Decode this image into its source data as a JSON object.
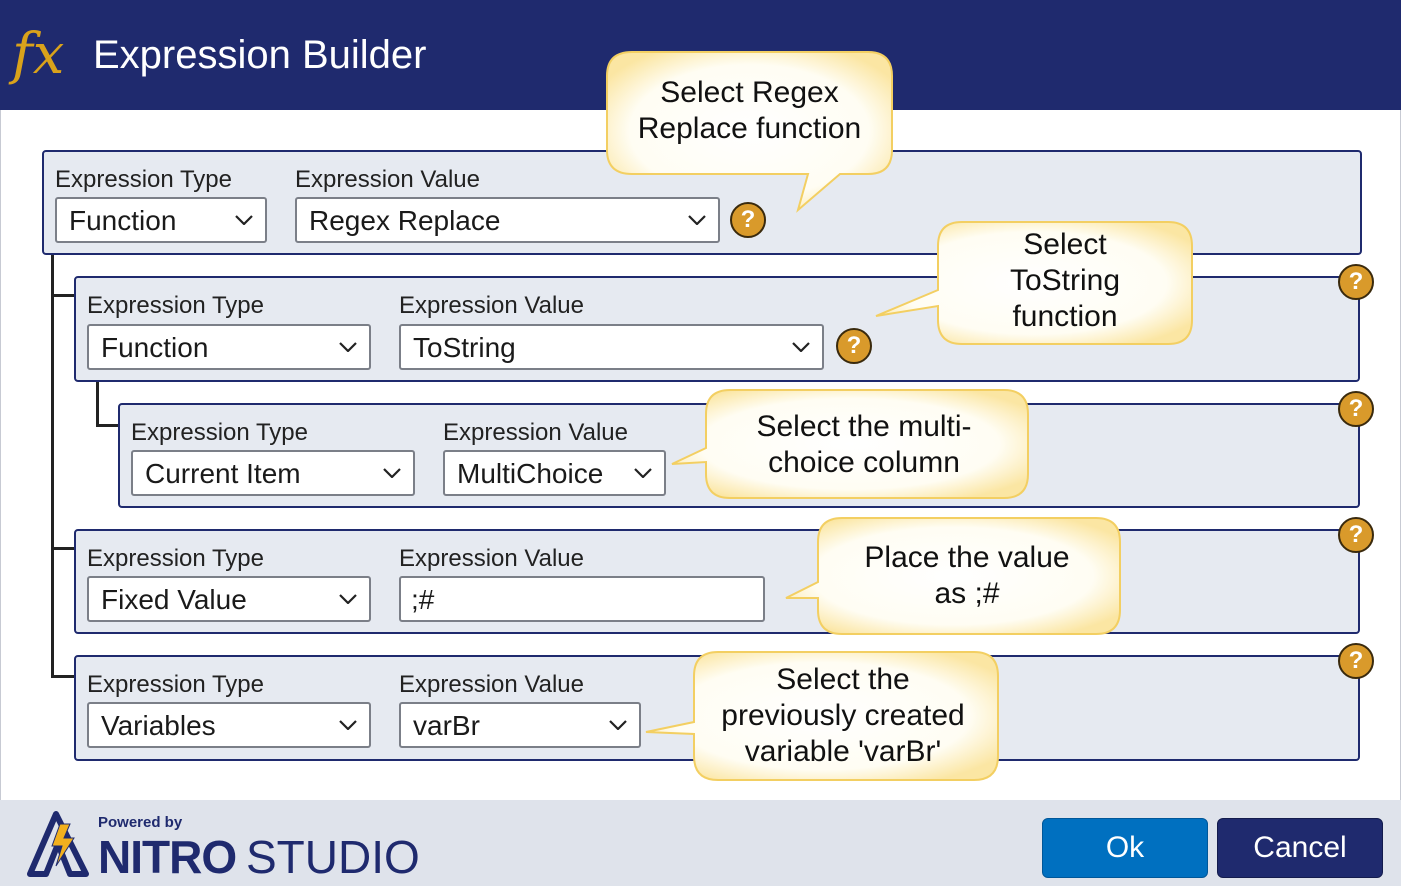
{
  "window": {
    "title": "Expression Builder",
    "icon": "fx-icon",
    "icon_text": "fx"
  },
  "labels": {
    "type": "Expression Type",
    "value": "Expression Value"
  },
  "rows": [
    {
      "type": "Function",
      "value": "Regex Replace"
    },
    {
      "type": "Function",
      "value": "ToString"
    },
    {
      "type": "Current Item",
      "value": "MultiChoice"
    },
    {
      "type": "Fixed Value",
      "value": ";#"
    },
    {
      "type": "Variables",
      "value": "varBr"
    }
  ],
  "help_glyph": "?",
  "callouts": [
    {
      "text": "Select Regex\nReplace function"
    },
    {
      "text": "Select\nToString\nfunction"
    },
    {
      "text": "Select the multi-\nchoice column"
    },
    {
      "text": "Place the value\nas ;#"
    },
    {
      "text": "Select the\npreviously created\nvariable 'varBr'"
    }
  ],
  "footer": {
    "powered_by": "Powered by",
    "brand_bold": "NITRO",
    "brand_light": "STUDIO",
    "ok_label": "Ok",
    "cancel_label": "Cancel"
  },
  "colors": {
    "titlebar": "#1f2a6e",
    "accent": "#d99a2b",
    "ok": "#0070c0",
    "cancel": "#1f2a6e"
  }
}
